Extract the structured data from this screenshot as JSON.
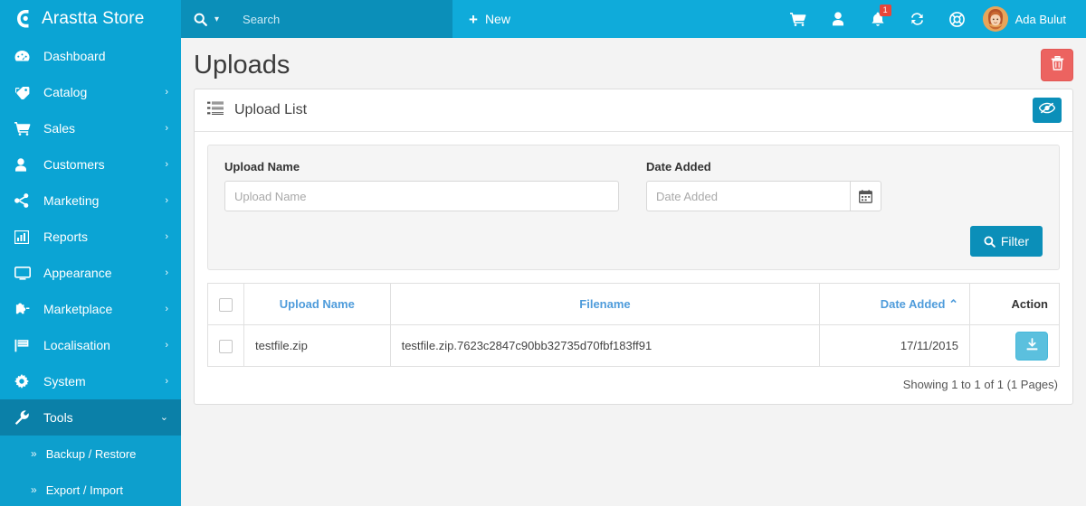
{
  "sidebar": {
    "brand": {
      "title": "Arastta Store",
      "logo_icon": "arastta-logo-icon"
    },
    "items": [
      {
        "label": "Dashboard",
        "icon": "dashboard-icon",
        "caret": "",
        "active": false
      },
      {
        "label": "Catalog",
        "icon": "tag-icon",
        "caret": "›",
        "active": false
      },
      {
        "label": "Sales",
        "icon": "cart-icon",
        "caret": "›",
        "active": false
      },
      {
        "label": "Customers",
        "icon": "user-icon",
        "caret": "›",
        "active": false
      },
      {
        "label": "Marketing",
        "icon": "share-icon",
        "caret": "›",
        "active": false
      },
      {
        "label": "Reports",
        "icon": "bar-chart-icon",
        "caret": "›",
        "active": false
      },
      {
        "label": "Appearance",
        "icon": "monitor-icon",
        "caret": "›",
        "active": false
      },
      {
        "label": "Marketplace",
        "icon": "puzzle-icon",
        "caret": "›",
        "active": false
      },
      {
        "label": "Localisation",
        "icon": "flag-icon",
        "caret": "›",
        "active": false
      },
      {
        "label": "System",
        "icon": "gear-icon",
        "caret": "›",
        "active": false
      },
      {
        "label": "Tools",
        "icon": "wrench-icon",
        "caret": "⌄",
        "active": true
      }
    ],
    "submenu": [
      {
        "label": "Backup / Restore",
        "chevron": "»"
      },
      {
        "label": "Export / Import",
        "chevron": "»"
      }
    ]
  },
  "header": {
    "search_placeholder": "Search",
    "search_value": "",
    "search_icon": "search-icon",
    "search_caret": "▾",
    "new_label": "New",
    "new_icon": "plus-icon",
    "icons": [
      {
        "name": "cart-icon",
        "badge": ""
      },
      {
        "name": "user-icon",
        "badge": ""
      },
      {
        "name": "bell-icon",
        "badge": "1"
      },
      {
        "name": "sync-icon",
        "badge": ""
      },
      {
        "name": "lifebuoy-icon",
        "badge": ""
      }
    ],
    "user_name": "Ada Bulut",
    "avatar_icon": "avatar"
  },
  "page": {
    "title": "Uploads",
    "delete_button_icon": "trash-icon"
  },
  "panel": {
    "title": "Upload List",
    "list_icon": "list-icon",
    "hide_button_icon": "eye-slash-icon"
  },
  "filter": {
    "upload_name": {
      "label": "Upload Name",
      "placeholder": "Upload Name",
      "value": ""
    },
    "date_added": {
      "label": "Date Added",
      "placeholder": "Date Added",
      "value": "",
      "addon_icon": "calendar-icon"
    },
    "button": {
      "label": "Filter",
      "icon": "search-icon"
    }
  },
  "table": {
    "columns": [
      {
        "label": "Upload Name",
        "sortable": true,
        "sort": ""
      },
      {
        "label": "Filename",
        "sortable": true,
        "sort": ""
      },
      {
        "label": "Date Added",
        "sortable": true,
        "sort": "⌃"
      },
      {
        "label": "Action",
        "sortable": false,
        "sort": ""
      }
    ],
    "rows": [
      {
        "upload_name": "testfile.zip",
        "filename": "testfile.zip.7623c2847c90bb32735d70fbf183ff91",
        "date_added": "17/11/2015",
        "action_icon": "download-icon"
      }
    ],
    "results_text": "Showing 1 to 1 of 1 (1 Pages)"
  },
  "colors": {
    "sidebar": "#0ba4d4",
    "sidebar_active": "#0b80a8",
    "submenu": "#0d9fcd",
    "header": "#0fabda",
    "search_zone": "#0b8fb9",
    "primary": "#0b8fb9",
    "danger": "#ec6360",
    "info": "#5bc0de",
    "link": "#4f9cdb",
    "badge": "#e8463a"
  }
}
